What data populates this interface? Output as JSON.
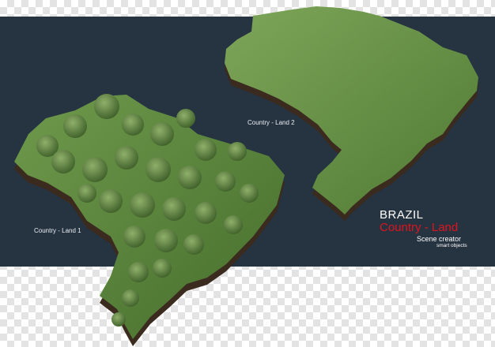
{
  "labels": {
    "land1": "Country - Land 1",
    "land2": "Country - Land 2"
  },
  "title": {
    "country_name": "BRAZIL",
    "subtitle": "Country - Land",
    "tagline": "Scene creator",
    "sub_tagline": "smart objects"
  },
  "colors": {
    "background_panel": "#263341",
    "accent_red": "#e0141d",
    "grass": "#5f8a3c",
    "soil": "#3b2a1e"
  },
  "icons": {
    "land1": "brazil-map-forest-illustration",
    "land2": "brazil-map-grass-illustration"
  }
}
